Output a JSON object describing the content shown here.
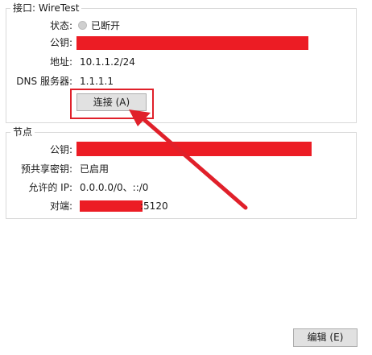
{
  "interface": {
    "title": "接口: WireTest",
    "status_label": "状态:",
    "status_value": "已断开",
    "public_key_label": "公钥:",
    "address_label": "地址:",
    "address_value": "10.1.1.2/24",
    "dns_label": "DNS 服务器:",
    "dns_value": "1.1.1.1",
    "connect_button": "连接 (A)"
  },
  "peer": {
    "title": "节点",
    "public_key_label": "公钥:",
    "preshared_label": "预共享密钥:",
    "preshared_value": "已启用",
    "allowed_ips_label": "允许的 IP:",
    "allowed_ips_value": "0.0.0.0/0、::/0",
    "endpoint_label": "对端:",
    "endpoint_value": ":5120"
  },
  "footer": {
    "edit_button": "编辑 (E)"
  },
  "colors": {
    "annotation": "#e0202a",
    "redaction": "#ec1c24",
    "button_face": "#e1e1e1"
  }
}
